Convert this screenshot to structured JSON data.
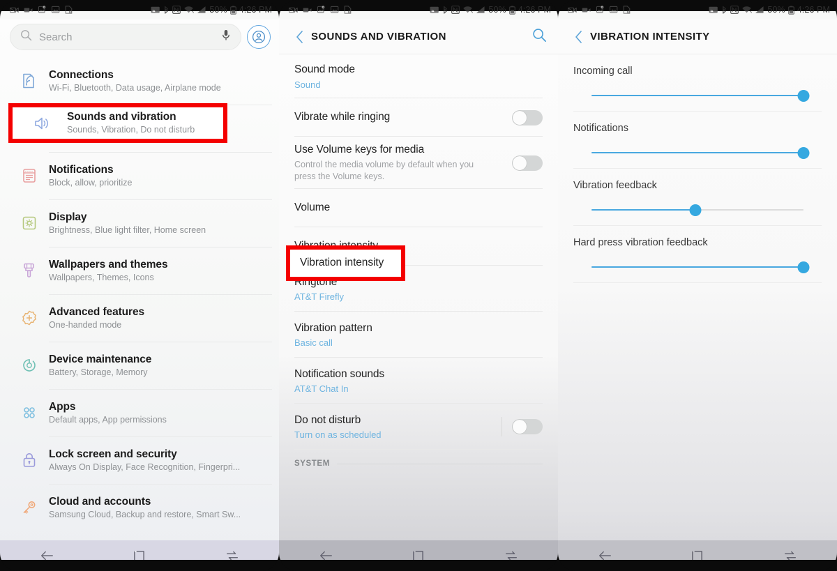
{
  "status_bar": {
    "time": "4:26 PM",
    "battery": "50%",
    "left_icons": [
      "camera-missed-icon",
      "video-camera-icon",
      "image-broken-icon",
      "gallery-icon",
      "file-icon"
    ],
    "right_icons": [
      "screen-cast-icon",
      "bluetooth-icon",
      "nfc-icon",
      "wifi-icon",
      "signal-icon",
      "battery-icon"
    ]
  },
  "panel1": {
    "search": {
      "placeholder": "Search",
      "mic_icon": "microphone-icon",
      "avatar_icon": "account-avatar-icon"
    },
    "items": [
      {
        "title": "Connections",
        "subtitle": "Wi-Fi, Bluetooth, Data usage, Airplane mode",
        "icon": "connections-icon",
        "color": "#7fa8d8"
      },
      {
        "title": "Sounds and vibration",
        "subtitle": "Sounds, Vibration, Do not disturb",
        "icon": "speaker-icon",
        "color": "#8fa9e0",
        "highlighted": true
      },
      {
        "title": "Notifications",
        "subtitle": "Block, allow, prioritize",
        "icon": "notifications-icon",
        "color": "#e9a0a0"
      },
      {
        "title": "Display",
        "subtitle": "Brightness, Blue light filter, Home screen",
        "icon": "display-icon",
        "color": "#b5c97e"
      },
      {
        "title": "Wallpapers and themes",
        "subtitle": "Wallpapers, Themes, Icons",
        "icon": "paintbrush-icon",
        "color": "#c9a6d8"
      },
      {
        "title": "Advanced features",
        "subtitle": "One-handed mode",
        "icon": "advanced-gear-icon",
        "color": "#e8b473"
      },
      {
        "title": "Device maintenance",
        "subtitle": "Battery, Storage, Memory",
        "icon": "maintenance-icon",
        "color": "#6fc0b4"
      },
      {
        "title": "Apps",
        "subtitle": "Default apps, App permissions",
        "icon": "apps-grid-icon",
        "color": "#7fc0e0"
      },
      {
        "title": "Lock screen and security",
        "subtitle": "Always On Display, Face Recognition, Fingerpri...",
        "icon": "lock-icon",
        "color": "#9b9bdb"
      },
      {
        "title": "Cloud and accounts",
        "subtitle": "Samsung Cloud, Backup and restore, Smart Sw...",
        "icon": "key-icon",
        "color": "#f0a878"
      }
    ]
  },
  "panel2": {
    "header": {
      "title": "SOUNDS AND VIBRATION",
      "back_icon": "back-chevron-icon",
      "search_icon": "search-icon"
    },
    "items": [
      {
        "title": "Sound mode",
        "value": "Sound",
        "type": "value"
      },
      {
        "title": "Vibrate while ringing",
        "type": "toggle",
        "toggle_on": false
      },
      {
        "title": "Use Volume keys for media",
        "desc": "Control the media volume by default when you press the Volume keys.",
        "type": "toggle",
        "toggle_on": false
      },
      {
        "title": "Volume",
        "type": "plain"
      },
      {
        "title": "Vibration intensity",
        "type": "plain",
        "highlighted": true
      },
      {
        "title": "Ringtone",
        "value": "AT&T Firefly",
        "type": "value"
      },
      {
        "title": "Vibration pattern",
        "value": "Basic call",
        "type": "value"
      },
      {
        "title": "Notification sounds",
        "value": "AT&T Chat In",
        "type": "value"
      },
      {
        "title": "Do not disturb",
        "value": "Turn on as scheduled",
        "type": "value-toggle",
        "toggle_on": false
      }
    ],
    "section_label": "SYSTEM"
  },
  "panel3": {
    "header": {
      "title": "VIBRATION INTENSITY",
      "back_icon": "back-chevron-icon"
    },
    "sliders": [
      {
        "label": "Incoming call",
        "value": 100
      },
      {
        "label": "Notifications",
        "value": 100
      },
      {
        "label": "Vibration feedback",
        "value": 49
      },
      {
        "label": "Hard press vibration feedback",
        "value": 100
      }
    ]
  },
  "navbar": {
    "back": "back-arrow-icon",
    "home": "home-square-icon",
    "recents": "recents-icon"
  },
  "colors": {
    "accent_blue": "#35a8e0",
    "link_blue": "#6eb4e0",
    "highlight_red": "#f40000"
  }
}
